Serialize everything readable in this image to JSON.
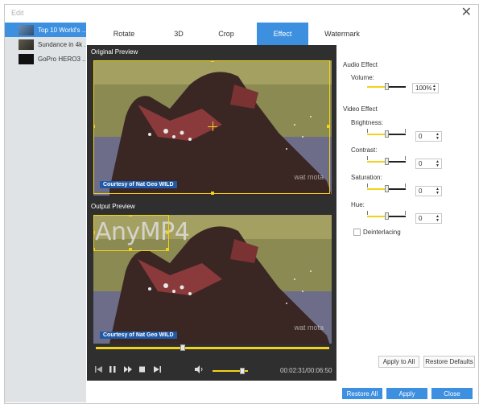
{
  "window": {
    "title": "Edit"
  },
  "files": [
    {
      "name": "Top 10 World's ...",
      "selected": true
    },
    {
      "name": "Sundance in 4k ..."
    },
    {
      "name": "GoPro HERO3 ..."
    }
  ],
  "tabs": [
    {
      "label": "Rotate"
    },
    {
      "label": "3D"
    },
    {
      "label": "Crop"
    },
    {
      "label": "Effect",
      "active": true
    },
    {
      "label": "Watermark"
    }
  ],
  "preview": {
    "original_label": "Original Preview",
    "output_label": "Output Preview",
    "courtesy_text": "Courtesy of Nat Geo WILD",
    "watermark_text": "AnyMP4",
    "corner_watermark": "wat mota",
    "timeline_progress": 0.37,
    "volume_level": 0.9,
    "timecode": "00:02:31/00:06:50"
  },
  "audio_effect": {
    "section_label": "Audio Effect",
    "volume_label": "Volume:",
    "volume_value": "100%",
    "volume_position": 0.5
  },
  "video_effect": {
    "section_label": "Video Effect",
    "brightness_label": "Brightness:",
    "brightness_value": "0",
    "contrast_label": "Contrast:",
    "contrast_value": "0",
    "saturation_label": "Saturation:",
    "saturation_value": "0",
    "hue_label": "Hue:",
    "hue_value": "0",
    "deinterlacing_label": "Deinterlacing",
    "deinterlacing_checked": false
  },
  "buttons": {
    "apply_to_all": "Apply to All",
    "restore_defaults": "Restore Defaults",
    "restore_all": "Restore All",
    "apply": "Apply",
    "close": "Close"
  },
  "colors": {
    "accent_blue": "#3d8fe0",
    "crop_yellow": "#f2d21b",
    "preview_bg": "#2f2f2f",
    "sidebar_bg": "#dfe3e6"
  },
  "icons": {
    "close": "close-icon",
    "prev": "skip-back-icon",
    "pause": "pause-icon",
    "forward": "fast-forward-icon",
    "stop": "stop-icon",
    "next": "skip-forward-icon",
    "volume": "volume-icon"
  }
}
